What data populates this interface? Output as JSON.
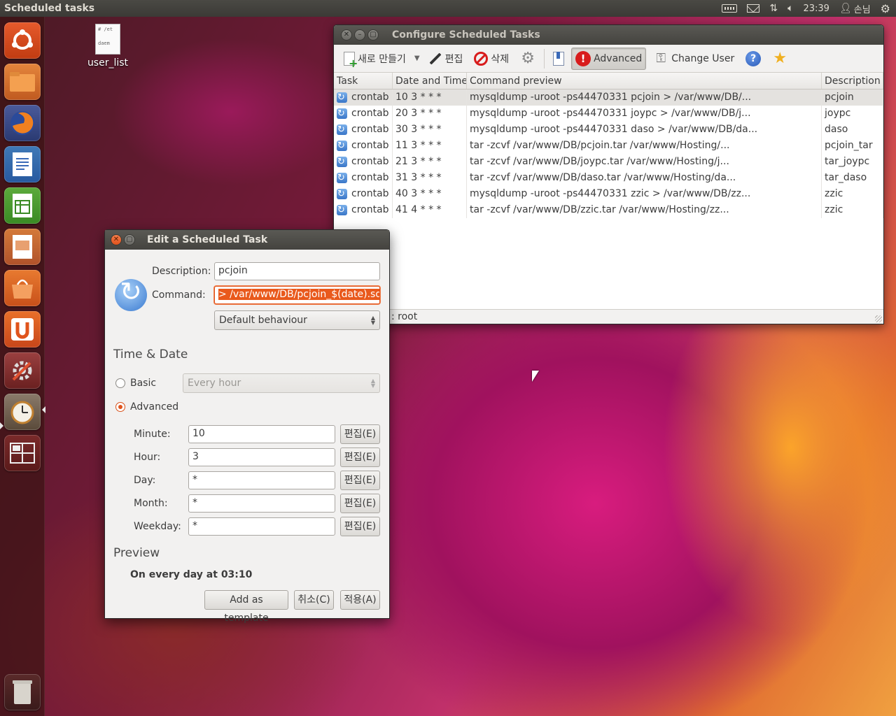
{
  "top_panel": {
    "title": "Scheduled tasks",
    "clock": "23:39",
    "user": "손님"
  },
  "desktop": {
    "file_name": "user_list",
    "file_preview_lines": [
      "# /et",
      "daem"
    ]
  },
  "main_window": {
    "title": "Configure Scheduled Tasks",
    "toolbar": {
      "new_label": "새로 만들기",
      "edit_label": "편집",
      "delete_label": "삭제",
      "advanced_label": "Advanced",
      "change_user_label": "Change User"
    },
    "columns": [
      "Task",
      "Date and Time",
      "Command preview",
      "Description"
    ],
    "rows": [
      {
        "task": "crontab",
        "when": "10 3 * * *",
        "command": "mysqldump -uroot -ps44470331 pcjoin > /var/www/DB/...",
        "description": "pcjoin"
      },
      {
        "task": "crontab",
        "when": "20 3 * * *",
        "command": "mysqldump -uroot -ps44470331 joypc > /var/www/DB/j...",
        "description": "joypc"
      },
      {
        "task": "crontab",
        "when": "30 3 * * *",
        "command": "mysqldump -uroot -ps44470331 daso > /var/www/DB/da...",
        "description": "daso"
      },
      {
        "task": "crontab",
        "when": "11 3 * * *",
        "command": "tar -zcvf /var/www/DB/pcjoin.tar /var/www/Hosting/...",
        "description": "pcjoin_tar"
      },
      {
        "task": "crontab",
        "when": "21 3 * * *",
        "command": "tar -zcvf /var/www/DB/joypc.tar /var/www/Hosting/j...",
        "description": "tar_joypc"
      },
      {
        "task": "crontab",
        "when": "31 3 * * *",
        "command": "tar -zcvf /var/www/DB/daso.tar /var/www/Hosting/da...",
        "description": "tar_daso"
      },
      {
        "task": "crontab",
        "when": "40 3 * * *",
        "command": "mysqldump -uroot -ps44470331 zzic > /var/www/DB/zz...",
        "description": "zzic"
      },
      {
        "task": "crontab",
        "when": "41 4 * * *",
        "command": "tar -zcvf /var/www/DB/zzic.tar /var/www/Hosting/zz...",
        "description": "zzic"
      }
    ],
    "status_text": ": root"
  },
  "dialog": {
    "title": "Edit a Scheduled Task",
    "description_label": "Description:",
    "description_value": "pcjoin",
    "command_label": "Command:",
    "command_value": "> /var/www/DB/pcjoin_$(date).sql",
    "behaviour_value": "Default behaviour",
    "time_date_heading": "Time & Date",
    "basic_label": "Basic",
    "basic_combo_value": "Every hour",
    "advanced_label": "Advanced",
    "fields": [
      {
        "label": "Minute:",
        "value": "10",
        "button": "편집(E)"
      },
      {
        "label": "Hour:",
        "value": "3",
        "button": "편집(E)"
      },
      {
        "label": "Day:",
        "value": "*",
        "button": "편집(E)"
      },
      {
        "label": "Month:",
        "value": "*",
        "button": "편집(E)"
      },
      {
        "label": "Weekday:",
        "value": "*",
        "button": "편집(E)"
      }
    ],
    "preview_heading": "Preview",
    "preview_text": "On every day at 03:10",
    "add_template_label": "Add as template",
    "cancel_label": "취소(C)",
    "apply_label": "적용(A)"
  },
  "colors": {
    "accent": "#e0541c",
    "panel": "#3b3a36",
    "window_bg": "#f2f1f0"
  }
}
